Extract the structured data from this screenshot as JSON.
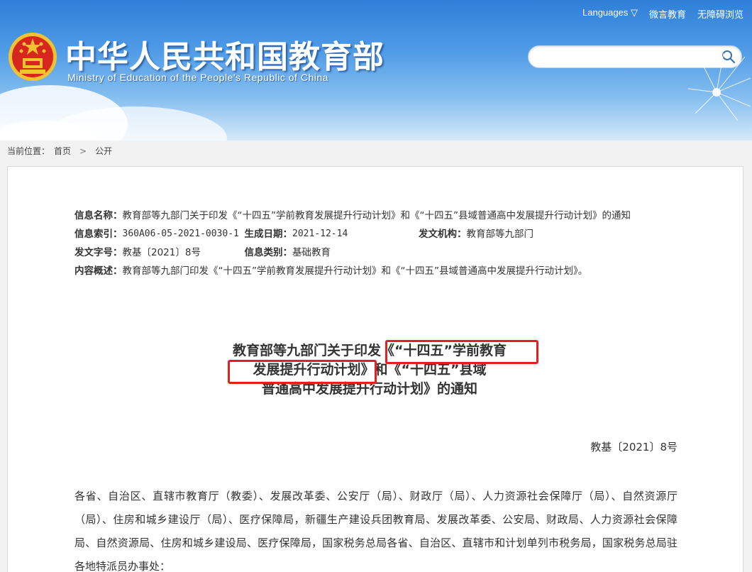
{
  "header": {
    "title": "中华人民共和国教育部",
    "subtitle": "Ministry of Education of the People's Republic of China",
    "links": [
      "Languages ▽",
      "微言教育",
      "无障碍浏览"
    ],
    "search": {
      "value": "",
      "placeholder": ""
    }
  },
  "breadcrumb": {
    "prefix": "当前位置：",
    "home": "首页",
    "sep": ">",
    "current": "公开"
  },
  "meta": {
    "name_label": "信息名称：",
    "name_value": "教育部等九部门关于印发《“十四五”学前教育发展提升行动计划》和《“十四五”县域普通高中发展提升行动计划》的通知",
    "index_label": "信息索引：",
    "index_value": "360A06-05-2021-0030-1",
    "date_label": "生成日期：",
    "date_value": "2021-12-14",
    "org_label": "发文机构：",
    "org_value": "教育部等九部门",
    "docno_label": "发文字号：",
    "docno_value": "教基〔2021〕8号",
    "category_label": "信息类别：",
    "category_value": "基础教育",
    "summary_label": "内容概述：",
    "summary_value": "教育部等九部门印发《“十四五”学前教育发展提升行动计划》和《“十四五”县域普通高中发展提升行动计划》。"
  },
  "document": {
    "title_line1": "教育部等九部门关于印发《“十四五”学前教育",
    "title_line2": "发展提升行动计划》和《“十四五”县域",
    "title_line3": "普通高中发展提升行动计划》的通知",
    "doc_no": "教基〔2021〕8号",
    "salutation": "各省、自治区、直辖市教育厅（教委）、发展改革委、公安厅（局）、财政厅（局）、人力资源社会保障厅（局）、自然资源厅（局）、住房和城乡建设厅（局）、医疗保障局，新疆生产建设兵团教育局、发展改革委、公安局、财政局、人力资源社会保障局、自然资源局、住房和城乡建设局、医疗保障局，国家税务总局各省、自治区、直辖市和计划单列市税务局，国家税务总局驻各地特派员办事处："
  },
  "colors": {
    "highlight": "#e51f1f",
    "header_blue": "#2f7fd8"
  }
}
